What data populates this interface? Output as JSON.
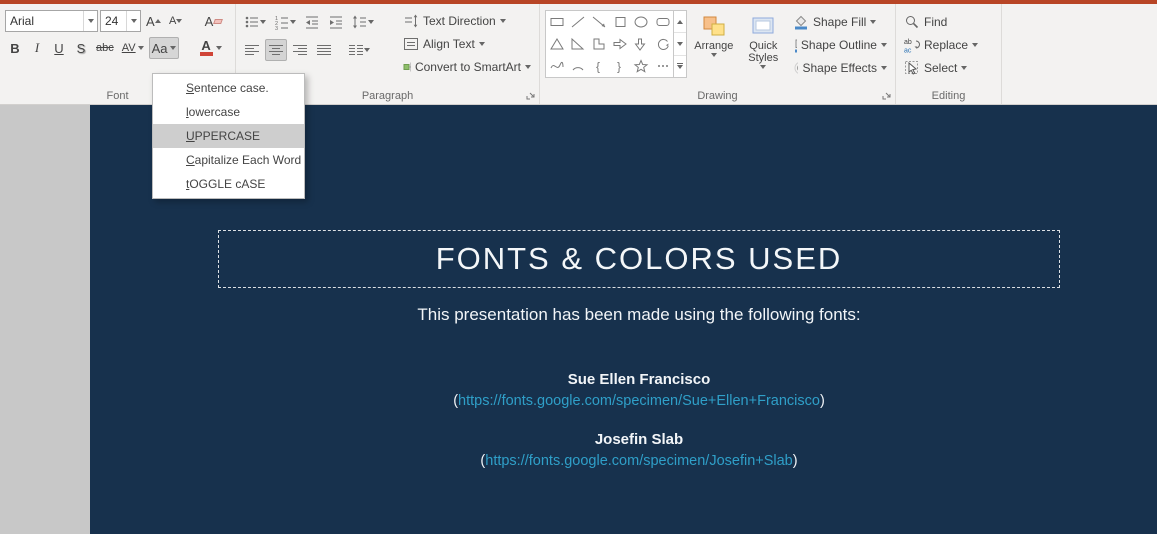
{
  "ribbon": {
    "font": {
      "label": "Font",
      "font_name": "Arial",
      "font_size": "24",
      "grow": "A",
      "shrink": "A",
      "clear_format": "A",
      "bold": "B",
      "italic": "I",
      "underline": "U",
      "shadow": "S",
      "strikethrough": "abc",
      "char_spacing": "AV",
      "change_case": "Aa",
      "font_color": "A",
      "font_color_swatch": "#d04437"
    },
    "paragraph": {
      "label": "Paragraph",
      "text_direction": "Text Direction",
      "align_text": "Align Text",
      "convert_smartart": "Convert to SmartArt"
    },
    "drawing": {
      "label": "Drawing",
      "arrange": "Arrange",
      "quick_styles": "Quick Styles",
      "shape_fill": "Shape Fill",
      "shape_outline": "Shape Outline",
      "shape_effects": "Shape Effects"
    },
    "editing": {
      "label": "Editing",
      "find": "Find",
      "replace": "Replace",
      "select": "Select"
    }
  },
  "case_menu": {
    "highlighted_index": 2,
    "items": [
      {
        "key": "S",
        "rest": "entence case."
      },
      {
        "key": "l",
        "rest": "owercase"
      },
      {
        "key": "U",
        "rest": "PPERCASE"
      },
      {
        "key": "C",
        "rest": "apitalize Each Word"
      },
      {
        "key": "t",
        "rest": "OGGLE cASE"
      }
    ]
  },
  "slide": {
    "title": "FONTS & COLORS USED",
    "intro": "This presentation has been made using the following fonts:",
    "paren_open": "(",
    "paren_close": ")",
    "fonts": [
      {
        "name": "Sue Ellen Francisco",
        "url": "https://fonts.google.com/specimen/Sue+Ellen+Francisco"
      },
      {
        "name": "Josefin Slab",
        "url": "https://fonts.google.com/specimen/Josefin+Slab"
      }
    ],
    "colors": {
      "background": "#17314d",
      "link": "#2f9fc8",
      "title": "#f4f7f9",
      "accent_bar": "#b84526"
    }
  }
}
